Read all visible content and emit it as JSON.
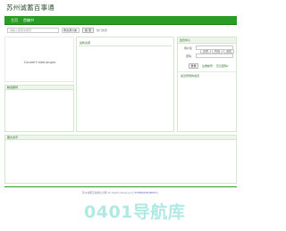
{
  "site": {
    "title": "苏州诚蓄百事通"
  },
  "nav": {
    "items": [
      "主页",
      "首编书"
    ]
  },
  "search": {
    "placeholder": "请输入搜索关键词",
    "select_value": "按资源分类",
    "button_label": "搜 索",
    "hot_label": "热门搜索"
  },
  "left": {
    "plugin_message": "Couldn't load plugin.",
    "section2_title": "精选服饰"
  },
  "middle": {
    "section_title": "最新资源"
  },
  "right": {
    "login_title": "会员中心",
    "tabs": [
      "注册",
      "找回",
      "退出"
    ],
    "username_label": "用户名",
    "password_label": "密码",
    "login_button": "登录",
    "forgot_link": "注册帐号",
    "register_link": "忘记密码?",
    "bottom_title": "最近登录的会员"
  },
  "lower": {
    "section_title": "图文资讯"
  },
  "footer": {
    "text": "苏州诚蓄百事通信息网 All Rights Reserved",
    "link": "[ SITEMAP/ROBOTS ]"
  },
  "watermark": {
    "text": "0401导航库"
  },
  "colors": {
    "brand_green": "#2a9b25",
    "panel_border": "#d4e5d0",
    "watermark": "#20c2b3"
  }
}
